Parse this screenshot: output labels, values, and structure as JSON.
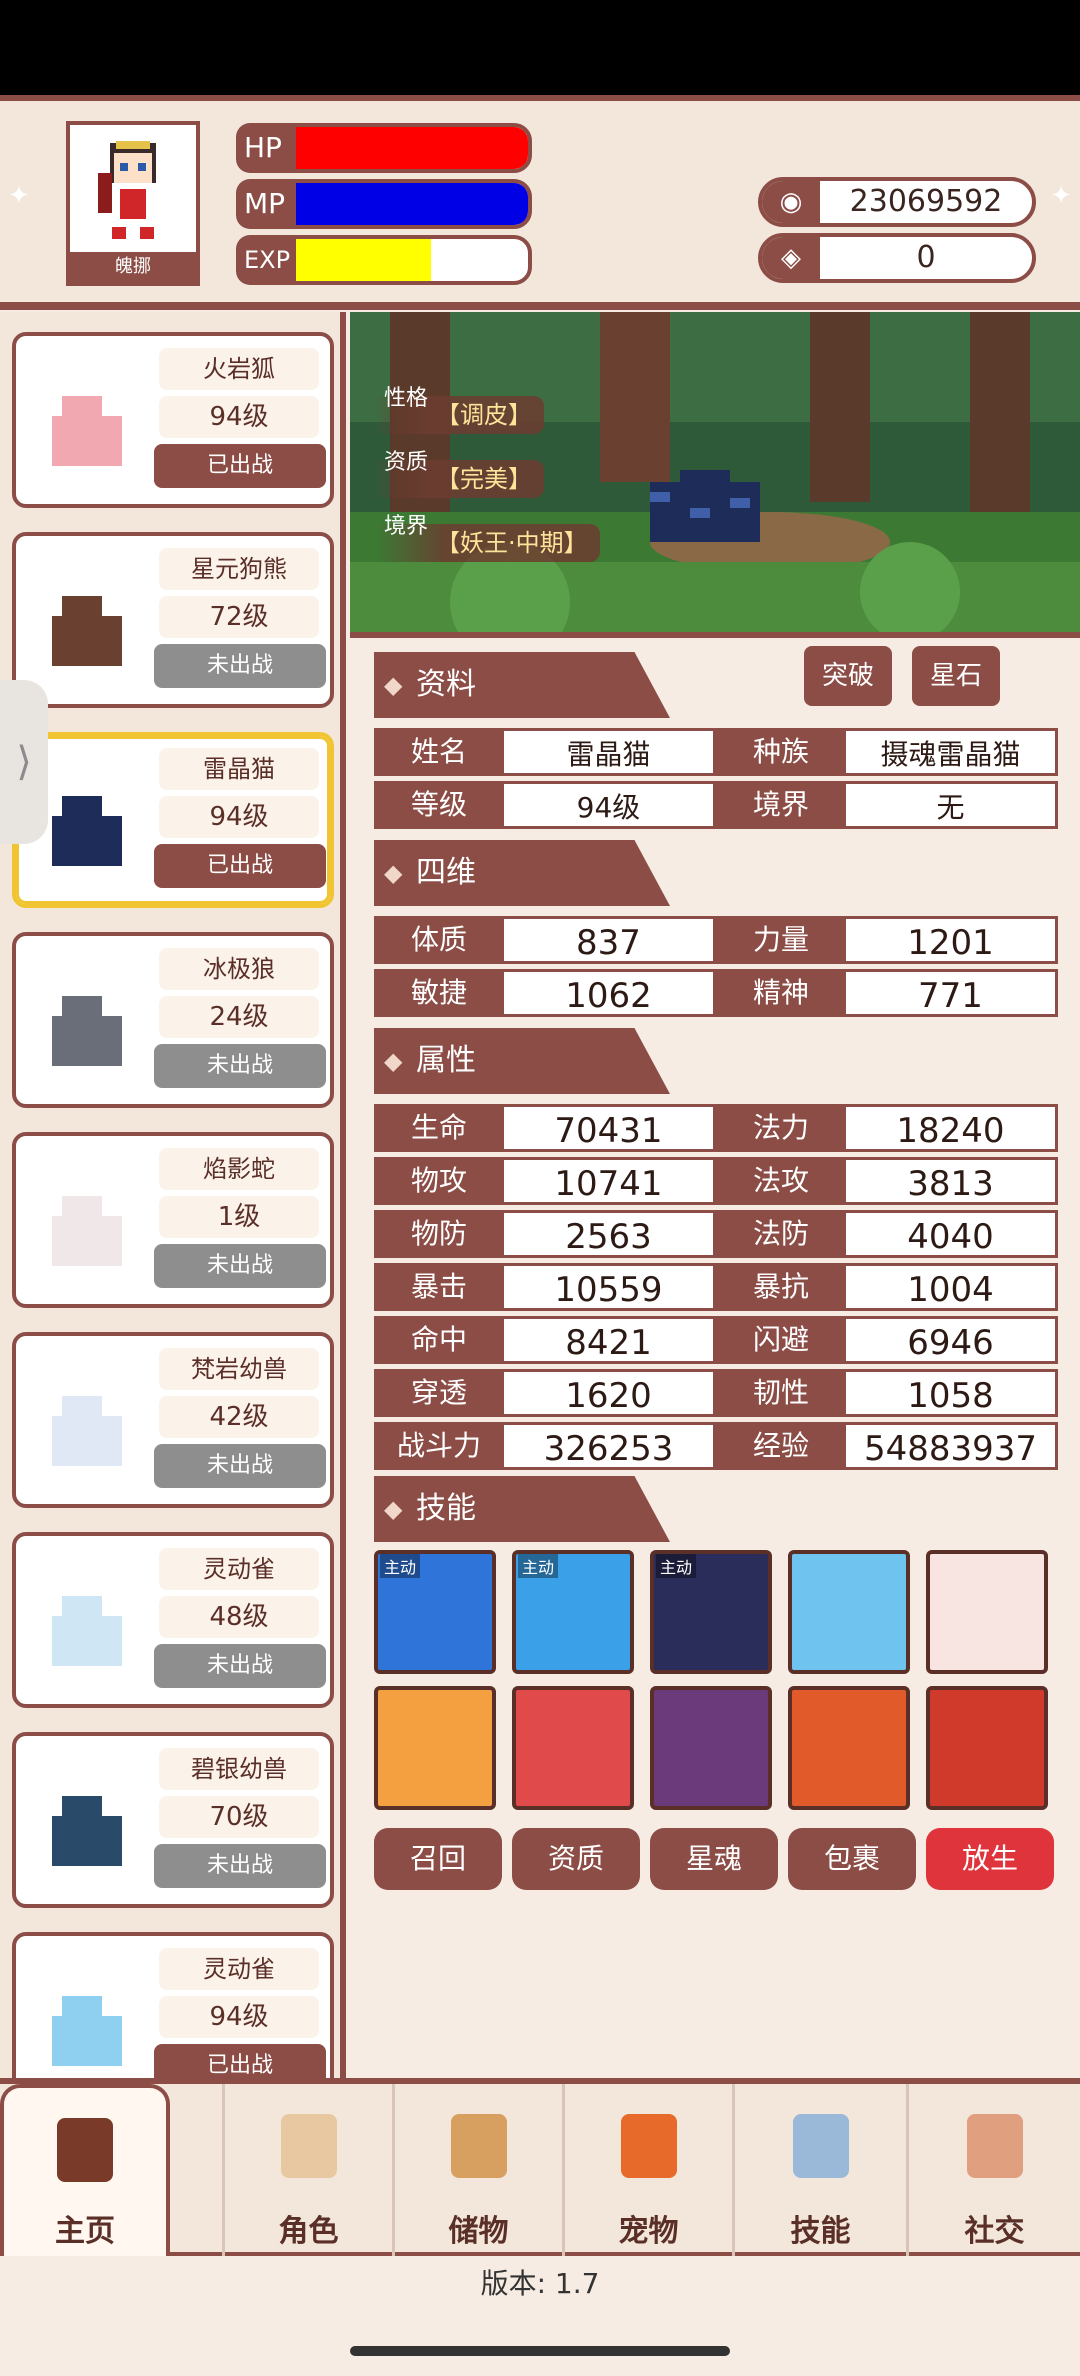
{
  "player": {
    "name": "魄挪",
    "hp_label": "HP",
    "mp_label": "MP",
    "exp_label": "EXP",
    "hp_fill": 1.0,
    "mp_fill": 1.0,
    "exp_fill": 0.58
  },
  "currency": {
    "coins": "23069592",
    "gems": "0"
  },
  "pets": [
    {
      "name": "火岩狐",
      "level": "94级",
      "status": "已出战"
    },
    {
      "name": "星元狗熊",
      "level": "72级",
      "status": "未出战"
    },
    {
      "name": "雷晶猫",
      "level": "94级",
      "status": "已出战"
    },
    {
      "name": "冰极狼",
      "level": "24级",
      "status": "未出战"
    },
    {
      "name": "焰影蛇",
      "level": "1级",
      "status": "未出战"
    },
    {
      "name": "梵岩幼兽",
      "level": "42级",
      "status": "未出战"
    },
    {
      "name": "灵动雀",
      "level": "48级",
      "status": "未出战"
    },
    {
      "name": "碧银幼兽",
      "level": "70级",
      "status": "未出战"
    },
    {
      "name": "灵动雀",
      "level": "94级",
      "status": "已出战"
    }
  ],
  "scene": {
    "tags": [
      {
        "key": "性格",
        "value": "【调皮】"
      },
      {
        "key": "资质",
        "value": "【完美】"
      },
      {
        "key": "境界",
        "value": "【妖王·中期】"
      }
    ]
  },
  "sections": {
    "info": "资料",
    "four": "四维",
    "attr": "属性",
    "skills": "技能"
  },
  "buttons": {
    "breakthrough": "突破",
    "starstone": "星石"
  },
  "info_rows": [
    {
      "k1": "姓名",
      "v1": "雷晶猫",
      "k2": "种族",
      "v2": "摄魂雷晶猫"
    },
    {
      "k1": "等级",
      "v1": "94级",
      "k2": "境界",
      "v2": "无"
    }
  ],
  "four_rows": [
    {
      "k1": "体质",
      "v1": "837",
      "k2": "力量",
      "v2": "1201"
    },
    {
      "k1": "敏捷",
      "v1": "1062",
      "k2": "精神",
      "v2": "771"
    }
  ],
  "attr_rows": [
    {
      "k1": "生命",
      "v1": "70431",
      "k2": "法力",
      "v2": "18240"
    },
    {
      "k1": "物攻",
      "v1": "10741",
      "k2": "法攻",
      "v2": "3813"
    },
    {
      "k1": "物防",
      "v1": "2563",
      "k2": "法防",
      "v2": "4040"
    },
    {
      "k1": "暴击",
      "v1": "10559",
      "k2": "暴抗",
      "v2": "1004"
    },
    {
      "k1": "命中",
      "v1": "8421",
      "k2": "闪避",
      "v2": "6946"
    },
    {
      "k1": "穿透",
      "v1": "1620",
      "k2": "韧性",
      "v2": "1058"
    },
    {
      "k1": "战斗力",
      "v1": "326253",
      "k2": "经验",
      "v2": "54883937"
    }
  ],
  "skill_active_label": "主动",
  "actions": [
    "召回",
    "资质",
    "星魂",
    "包裹",
    "放生"
  ],
  "nav": [
    "主页",
    "角色",
    "储物",
    "宠物",
    "技能",
    "社交"
  ],
  "version": "版本: 1.7",
  "colors": {
    "primary": "#8b4d46",
    "hp": "#ff0000",
    "mp": "#0000e6",
    "exp": "#ffff00",
    "release": "#e0343d"
  }
}
